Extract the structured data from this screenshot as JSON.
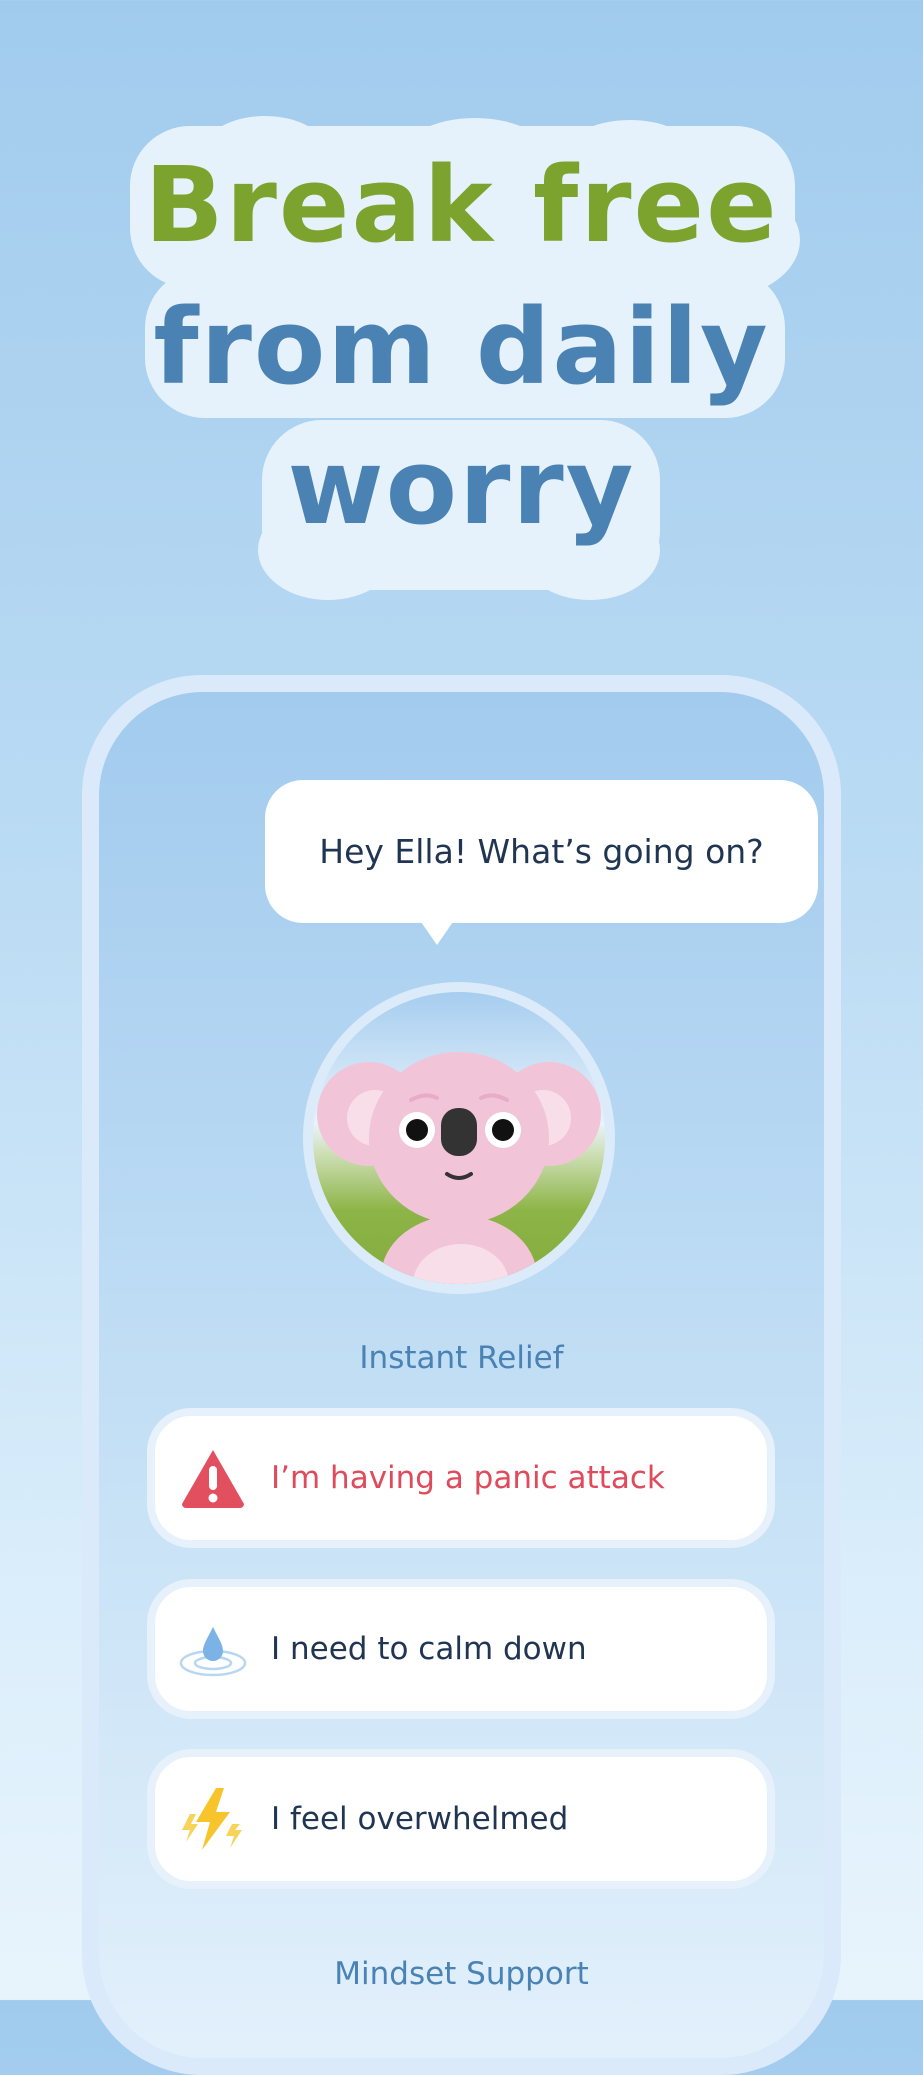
{
  "headline": {
    "line1": "Break free",
    "line2": "from daily",
    "line3": "worry"
  },
  "phone": {
    "greeting": "Hey Ella! What’s going on?",
    "avatar": "koala-avatar",
    "sections": [
      {
        "label": "Instant Relief",
        "options": [
          {
            "label": "I’m having a panic attack",
            "icon": "warning-triangle-icon",
            "color": "#e04b5c"
          },
          {
            "label": "I need to calm down",
            "icon": "water-drop-icon"
          },
          {
            "label": "I feel overwhelmed",
            "icon": "lightning-icon"
          }
        ]
      },
      {
        "label": "Mindset Support"
      }
    ]
  },
  "colors": {
    "headline_green": "#7da32f",
    "headline_blue": "#4a82b4",
    "text_dark": "#1f3552",
    "alert_red": "#e04b5c"
  }
}
